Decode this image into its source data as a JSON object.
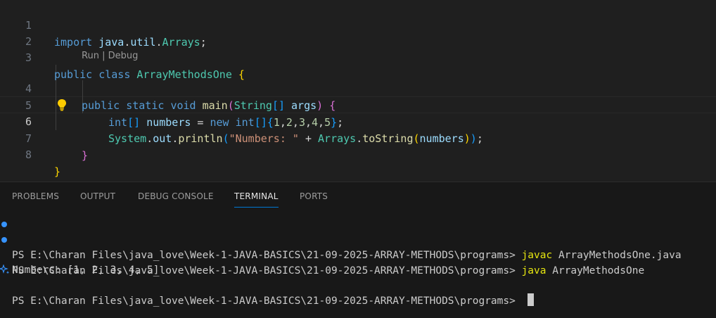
{
  "editor": {
    "line_numbers": [
      "1",
      "2",
      "3",
      "4",
      "5",
      "6",
      "7",
      "8"
    ],
    "active_line": "6",
    "codelens": {
      "run": "Run",
      "sep": " | ",
      "debug": "Debug"
    },
    "lines": {
      "l1": {
        "kw": "import",
        "pkg": "java",
        "dot1": ".",
        "pkg2": "util",
        "dot2": ".",
        "cls": "Arrays",
        "semi": ";"
      },
      "l3": {
        "kw1": "public",
        "kw2": "class",
        "cls": "ArrayMethodsOne",
        "brace": "{"
      },
      "l4": {
        "kw1": "public",
        "kw2": "static",
        "kw3": "void",
        "fn": "main",
        "p1": "(",
        "type": "String",
        "arr": "[]",
        "arg": "args",
        "p2": ")",
        "brace": "{"
      },
      "l5": {
        "type": "int",
        "arr": "[]",
        "var": "numbers",
        "eq": " = ",
        "kw": "new",
        "type2": "int",
        "arr2": "[]",
        "open": "{",
        "n1": "1",
        "n2": "2",
        "n3": "3",
        "n4": "4",
        "n5": "5",
        "comma": ",",
        "close": "}",
        "semi": ";"
      },
      "l6": {
        "sys": "System",
        "dot1": ".",
        "out": "out",
        "dot2": ".",
        "fn": "println",
        "p1": "(",
        "str": "\"Numbers: \"",
        "plus": " + ",
        "cls": "Arrays",
        "dot3": ".",
        "fn2": "toString",
        "p2": "(",
        "arg": "numbers",
        "p3": ")",
        "p4": ")",
        "semi": ";"
      },
      "l7": {
        "brace": "}"
      },
      "l8": {
        "brace": "}"
      }
    }
  },
  "panel": {
    "tabs": [
      "PROBLEMS",
      "OUTPUT",
      "DEBUG CONSOLE",
      "TERMINAL",
      "PORTS"
    ],
    "active_tab": "TERMINAL",
    "terminal": {
      "prompt": "PS E:\\Charan Files\\java_love\\Week-1-JAVA-BASICS\\21-09-2025-ARRAY-METHODS\\programs> ",
      "line1_cmd": "javac",
      "line1_arg": " ArrayMethodsOne.java",
      "line2_cmd": "java",
      "line2_arg": " ArrayMethodsOne",
      "output": "Numbers: [1, 2, 3, 4, 5]"
    }
  },
  "colors": {
    "editor_bg": "#1f1f1f",
    "panel_bg": "#181818",
    "accent": "#0078d4",
    "command": "#e5e510",
    "keyword": "#569cd6",
    "type": "#4ec9b0"
  }
}
